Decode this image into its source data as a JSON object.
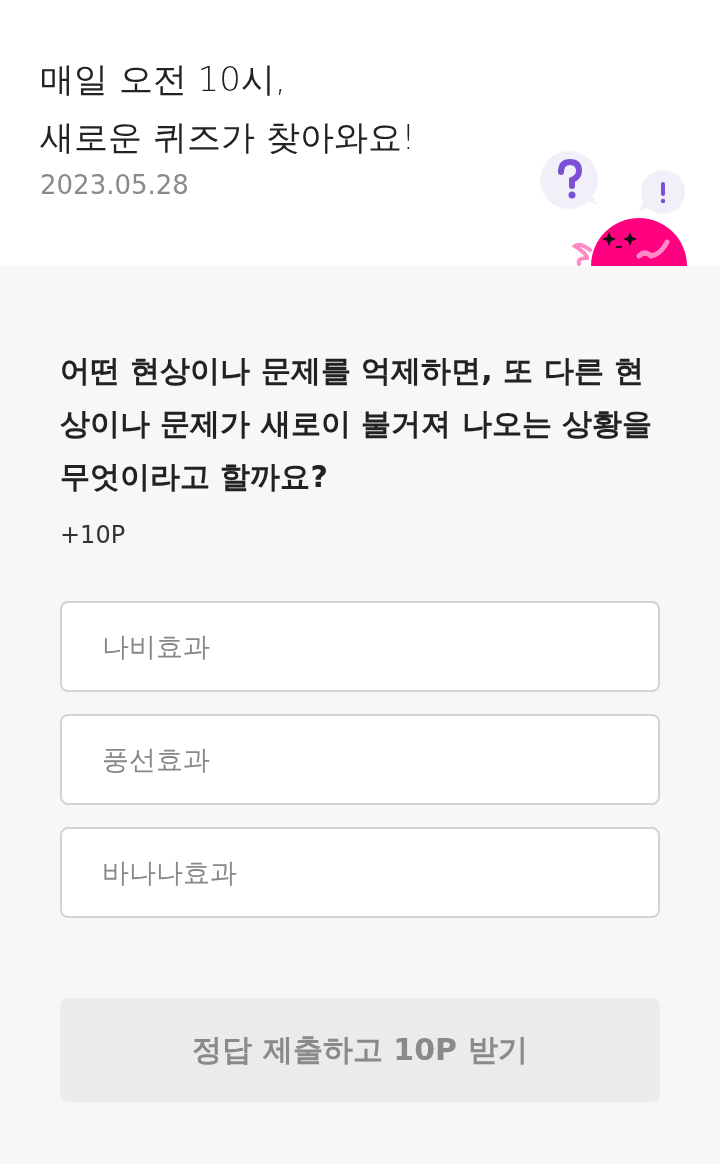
{
  "header": {
    "title_lines": [
      "매일 오전 10시,",
      "새로운 퀴즈가 찾아와요!"
    ],
    "date": "2023.05.28"
  },
  "quiz": {
    "question": "어떤 현상이나 문제를 억제하면, 또 다른 현상이나 문제가 새로이 불거져 나오는 상황을 무엇이라고 할까요?",
    "reward": "+10P",
    "options": [
      {
        "label": "나비효과",
        "selected": false
      },
      {
        "label": "풍선효과",
        "selected": false
      },
      {
        "label": "바나나효과",
        "selected": false
      }
    ]
  },
  "submit": {
    "label": "정답 제출하고 10P 받기",
    "disabled": true
  }
}
